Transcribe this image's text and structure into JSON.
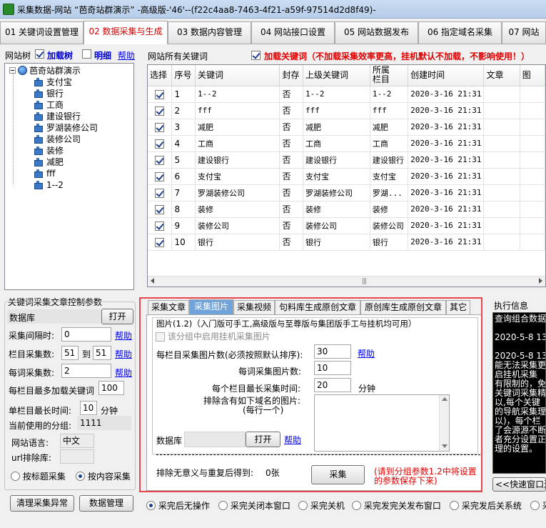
{
  "window": {
    "title": "采集数据-网站 “芭奇站群演示” -高级版-'46'--(f22c4aa8-7463-4f21-a59f-97514d2d8f49)-"
  },
  "main_tabs": [
    {
      "label": "01 关键词设置管理"
    },
    {
      "label": "02 数据采集与生成"
    },
    {
      "label": "03 数据内容管理"
    },
    {
      "label": "04 网站接口设置"
    },
    {
      "label": "05 网站数据发布"
    },
    {
      "label": "06 指定域名采集"
    },
    {
      "label": "07 网站"
    }
  ],
  "tree_toolbar": {
    "label": "网站树",
    "load_words": "加载树",
    "detail": "明细",
    "help": "帮助"
  },
  "tree": {
    "root": "芭奇站群演示",
    "children": [
      "支付宝",
      "银行",
      "工商",
      "建设银行",
      "罗湖装修公司",
      "装修公司",
      "装修",
      "减肥",
      "fff",
      "1--2"
    ]
  },
  "grid_header": {
    "label": "网站所有关键词",
    "load_keywords": "加载关键词（不加载采集效率更高，挂机默认不加载，不影响使用！）"
  },
  "grid": {
    "columns": [
      "选择",
      "序号",
      "关键词",
      "封存",
      "上级关键词",
      "所属\n栏目",
      "创建时间",
      "文章",
      "图"
    ],
    "rows": [
      {
        "seq": "1",
        "keyword": "1--2",
        "sealed": "否",
        "parent": "1--2",
        "column": "1--2",
        "created": "2020-3-16 21:31"
      },
      {
        "seq": "2",
        "keyword": "fff",
        "sealed": "否",
        "parent": "fff",
        "column": "fff",
        "created": "2020-3-16 21:31"
      },
      {
        "seq": "3",
        "keyword": "减肥",
        "sealed": "否",
        "parent": "减肥",
        "column": "减肥",
        "created": "2020-3-16 21:31"
      },
      {
        "seq": "4",
        "keyword": "工商",
        "sealed": "否",
        "parent": "工商",
        "column": "工商",
        "created": "2020-3-16 21:31"
      },
      {
        "seq": "5",
        "keyword": "建设银行",
        "sealed": "否",
        "parent": "建设银行",
        "column": "建设银行",
        "created": "2020-3-16 21:31"
      },
      {
        "seq": "6",
        "keyword": "支付宝",
        "sealed": "否",
        "parent": "支付宝",
        "column": "支付宝",
        "created": "2020-3-16 21:31"
      },
      {
        "seq": "7",
        "keyword": "罗湖装修公司",
        "sealed": "否",
        "parent": "罗湖装修公司",
        "column": "罗湖...",
        "created": "2020-3-16 21:31"
      },
      {
        "seq": "8",
        "keyword": "装修",
        "sealed": "否",
        "parent": "装修",
        "column": "装修",
        "created": "2020-3-16 21:31"
      },
      {
        "seq": "9",
        "keyword": "装修公司",
        "sealed": "否",
        "parent": "装修公司",
        "column": "装修公司",
        "created": "2020-3-16 21:31"
      },
      {
        "seq": "10",
        "keyword": "银行",
        "sealed": "否",
        "parent": "银行",
        "column": "银行",
        "created": "2020-3-16 21:31"
      }
    ]
  },
  "left_panel": {
    "group_title": "关键词采集文章控制参数",
    "database_label": "数据库",
    "open_button": "打开",
    "interval_label": "采集间隔时:",
    "interval_value": "0",
    "column_count_label": "栏目采集数:",
    "column_count_from": "51",
    "column_count_to_label": "到",
    "column_count_to": "51",
    "per_count_label": "每词采集数:",
    "per_count_value": "2",
    "max_keywords_label": "每栏目最多加载关键词",
    "max_keywords_value": "100",
    "max_time_label": "单栏目最长时间:",
    "max_time_value": "10",
    "max_time_unit": "分钟",
    "current_group_label": "当前使用的分组:",
    "current_group_value": "1111",
    "language_label": "网站语言:",
    "language_value": "中文",
    "url_exclude_label": "url排除库:",
    "help": "帮助",
    "radio_title": "按标题采集",
    "radio_content": "按内容采集",
    "clear_button": "清理采集异常",
    "db_manage_button": "数据管理"
  },
  "sub_tabs": [
    {
      "label": "采集文章"
    },
    {
      "label": "采集图片"
    },
    {
      "label": "采集视频"
    },
    {
      "label": "句料库生成原创文章"
    },
    {
      "label": "原创库生成原创文章"
    },
    {
      "label": "其它"
    }
  ],
  "image_panel": {
    "group_title": "图片(1.2)（入门版可手工,高级版与至尊版与集团版手工与挂机均可用）",
    "enable_label": "该分组中启用挂机采集图片",
    "per_column_label": "每栏目采集图片数(必须按照默认排序):",
    "per_column_value": "30",
    "per_word_label": "每词采集图片数:",
    "per_word_value": "10",
    "max_time_label": "每个栏目最长采集时间:",
    "max_time_value": "20",
    "max_time_unit": "分钟",
    "exclude_label": "排除含有如下域名的图片:",
    "exclude_hint": "(每行一个)",
    "db_label": "数据库",
    "open_button": "打开",
    "help": "帮助",
    "result_label": "排除无意义与重复后得到:",
    "result_value": "0张",
    "collect_button": "采集",
    "note": "(请到分组参数1.2中将设置的参数保存下来)"
  },
  "exec_info": {
    "title": "执行信息",
    "lines": [
      "查询组合数据",
      "",
      "2020-5-8 13:",
      "",
      "2020-5-8 13:",
      "能无法采集更",
      "启挂机采集",
      "有限制的，免",
      "关键词采集精",
      "以,每个关键",
      "的导航采集理",
      "以)，每个栏",
      "了会源源不断",
      "者充分设置正",
      "理的设置。"
    ],
    "quick_connect": "<<快速窗口连"
  },
  "bottom_options": [
    {
      "label": "采完后无操作",
      "selected": true
    },
    {
      "label": "采完关闭本窗口",
      "selected": false
    },
    {
      "label": "采完关机",
      "selected": false
    },
    {
      "label": "采完发完关发布窗口",
      "selected": false
    },
    {
      "label": "采完发后关系统",
      "selected": false
    },
    {
      "label": "采",
      "selected": false
    }
  ],
  "colors": {
    "active_tab_text": "#d40000",
    "accent_red": "#e00000",
    "link_blue": "#0000ee",
    "subtab_active": "#6fa3d9",
    "highlight_frame": "#e8454c"
  }
}
